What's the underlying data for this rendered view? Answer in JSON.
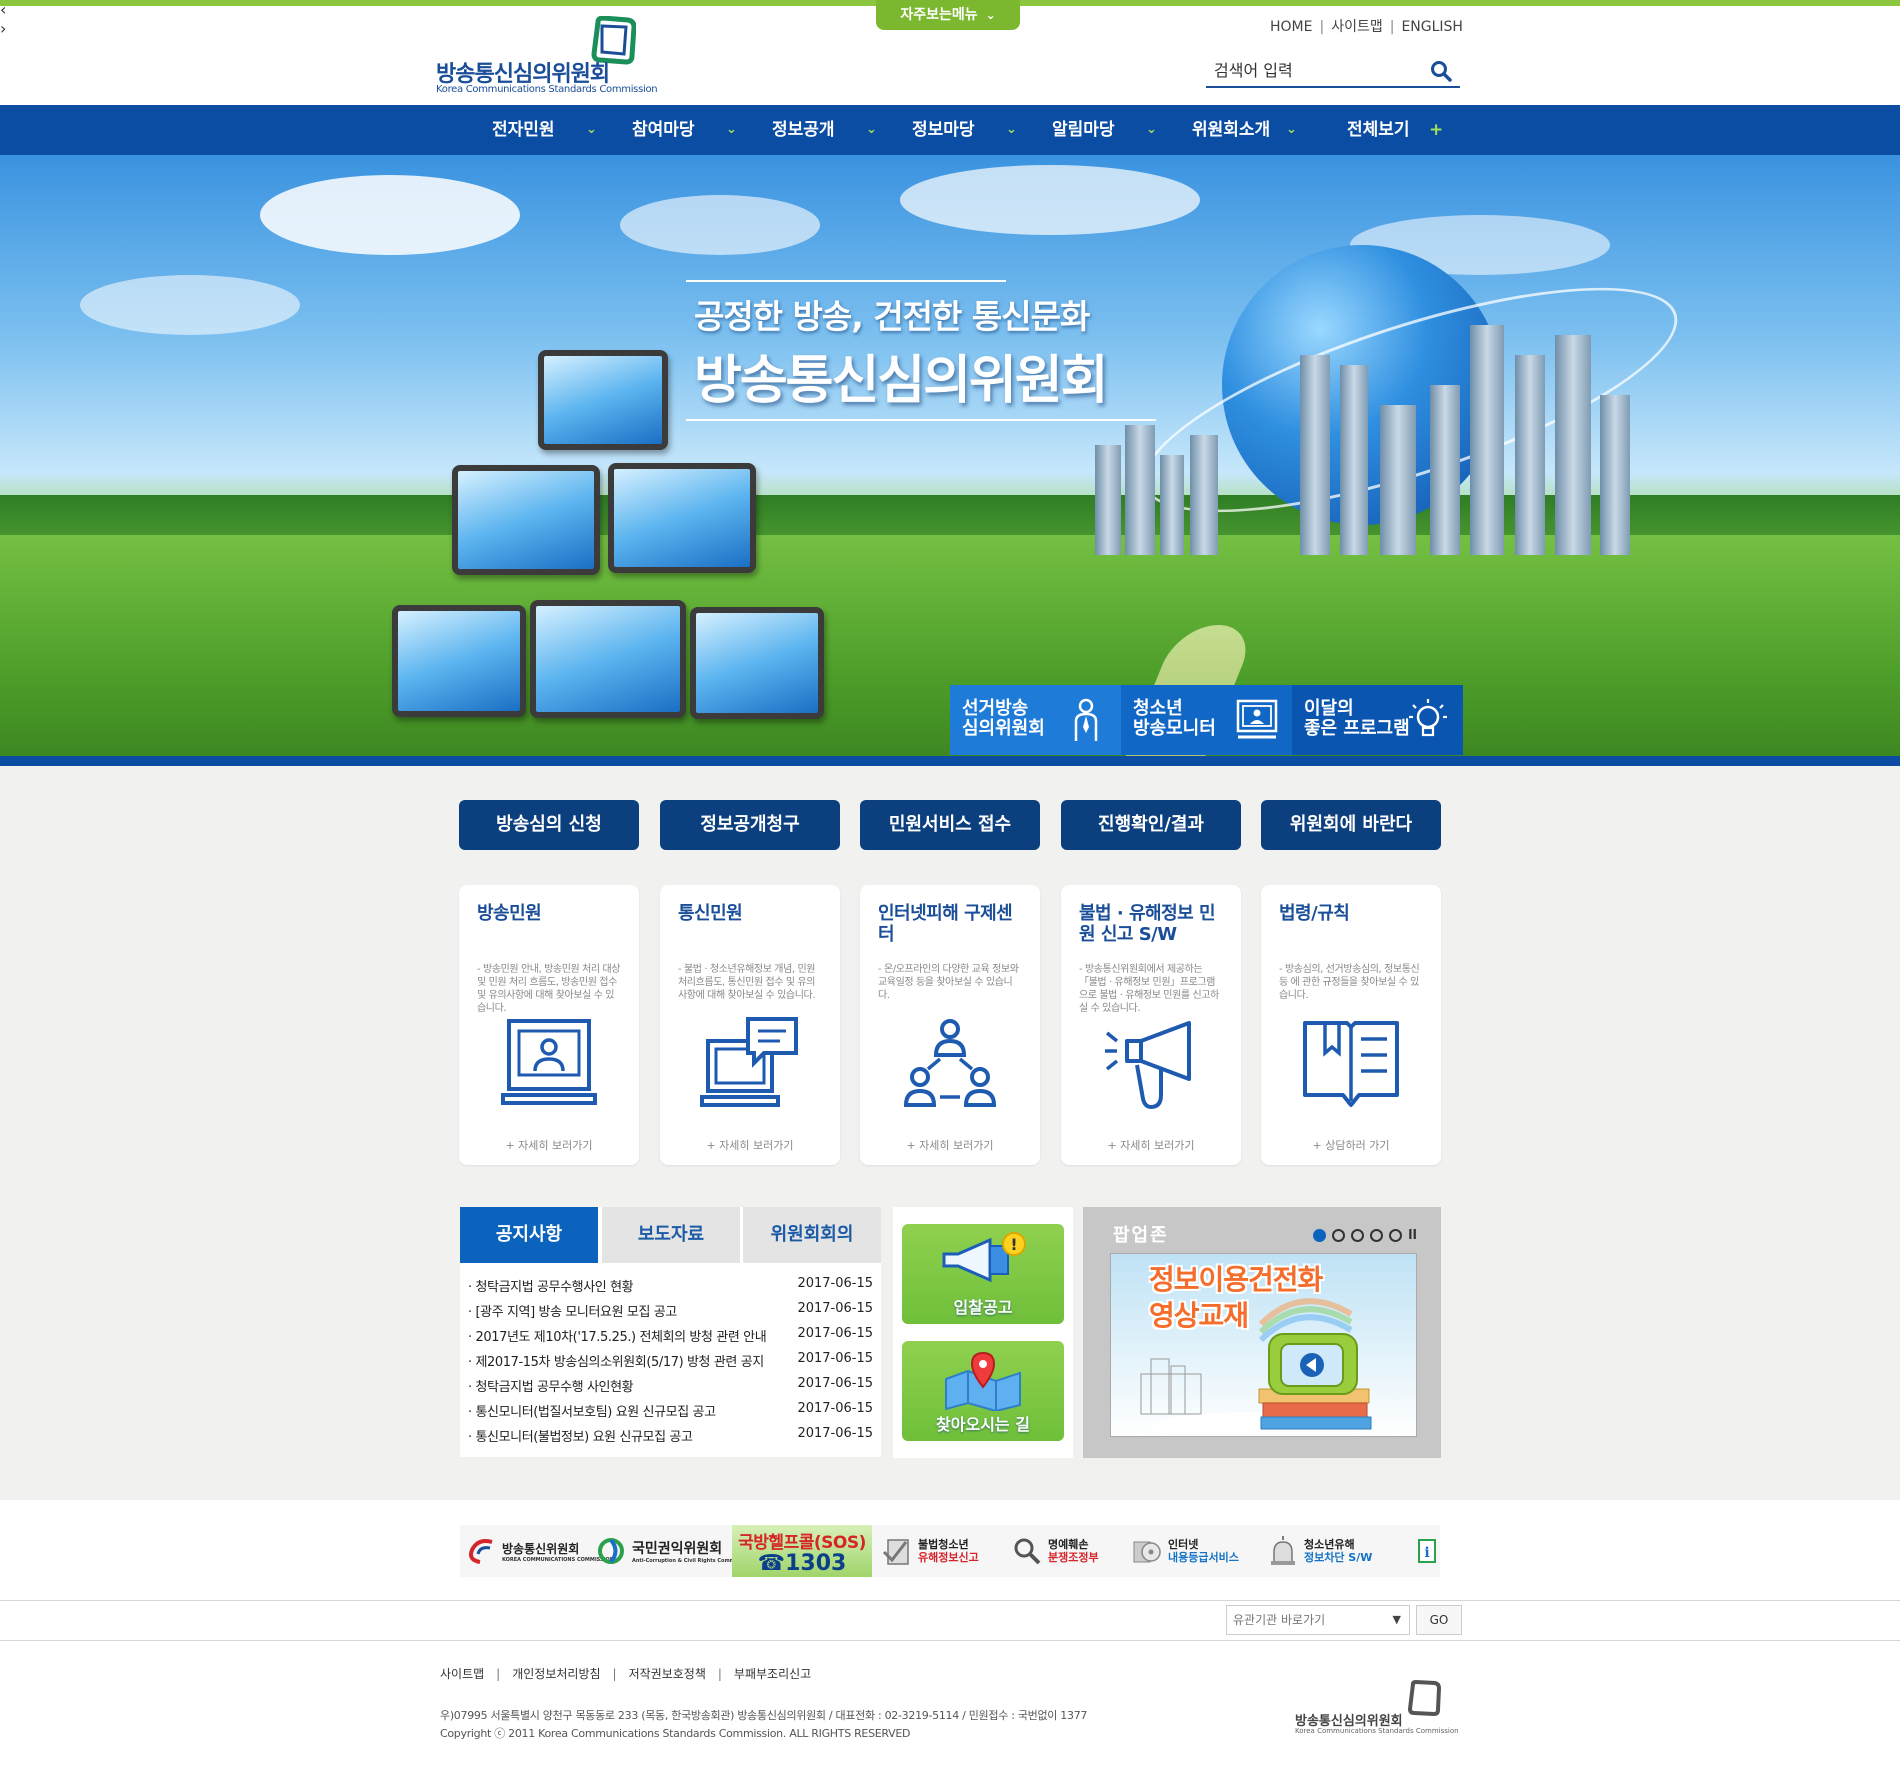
{
  "header": {
    "quick_menu": "자주보는메뉴",
    "logo_name": "방송통신심의위원회",
    "logo_eng": "Korea Communications Standards Commission",
    "util": [
      "HOME",
      "사이트맵",
      "ENGLISH"
    ],
    "search_value": "검색어 입력"
  },
  "gnb": [
    "전자민원",
    "참여마당",
    "정보공개",
    "정보마당",
    "알림마당",
    "위원회소개",
    "전체보기"
  ],
  "hero": {
    "sub": "공정한 방송, 건전한 통신문화",
    "main": "방송통신심의위원회",
    "quick": [
      {
        "line1": "선거방송",
        "line2": "심의위원회",
        "icon": "person-icon"
      },
      {
        "line1": "청소년",
        "line2": "방송모니터",
        "icon": "monitor-person-icon"
      },
      {
        "line1": "이달의",
        "line2": "좋은 프로그램",
        "icon": "lightbulb-icon"
      }
    ],
    "quick_colors": [
      "#1e7bd8",
      "#1067c6",
      "#0a55b0"
    ]
  },
  "buttons": [
    "방송심의 신청",
    "정보공개청구",
    "민원서비스 접수",
    "진행확인/결과",
    "위원회에 바란다"
  ],
  "cards": [
    {
      "title": "방송민원",
      "desc": "- 방송민원 안내, 방송민원 처리 대상 및 민원 처리 흐름도, 방송민원 접수 및 유의사항에 대해 찾아보실 수 있습니다.",
      "more": "+ 자세히 보러가기",
      "icon": "monitor-user-icon"
    },
    {
      "title": "통신민원",
      "desc": "- 불법 · 청소년유해정보 개념, 민원 처리흐름도, 통신민원 접수 및 유의사항에 대해 찾아보실 수 있습니다.",
      "more": "+ 자세히 보러가기",
      "icon": "computer-chat-icon"
    },
    {
      "title": "인터넷피해 구제센터",
      "desc": "- 온/오프라인의 다양한 교육 정보와 교육일정 등을 찾아보실 수 있습니다.",
      "more": "+ 자세히 보러가기",
      "icon": "people-network-icon"
    },
    {
      "title": "불법 · 유해정보 민원 신고 S/W",
      "desc": "- 방송통신위원회에서 제공하는 「불법 · 유해정보 민원」프로그램으로 불법 · 유해정보 민원를 신고하실 수 있습니다.",
      "more": "+ 자세히 보러가기",
      "icon": "megaphone-icon"
    },
    {
      "title": "법령/규칙",
      "desc": "- 방송심의, 선거방송심의, 정보통신 등 에 관한 규정들을 찾아보실 수 있습니다.",
      "more": "+ 상담하러 가기",
      "icon": "open-book-icon"
    }
  ],
  "board": {
    "tabs": [
      "공지사항",
      "보도자료",
      "위원회회의"
    ],
    "rows": [
      {
        "text": "· 청탁금지법 공무수행사인 현황",
        "date": "2017-06-15"
      },
      {
        "text": "· [광주 지역] 방송 모니터요원 모집 공고",
        "date": "2017-06-15"
      },
      {
        "text": "· 2017년도 제10차('17.5.25.) 전체회의 방청 관련 안내",
        "date": "2017-06-15"
      },
      {
        "text": "· 제2017-15차 방송심의소위원회(5/17) 방청 관련 공지",
        "date": "2017-06-15"
      },
      {
        "text": "· 청탁금지법 공무수행 사인현황",
        "date": "2017-06-15"
      },
      {
        "text": "· 통신모니터(법질서보호팀) 요원 신규모집 공고",
        "date": "2017-06-15"
      },
      {
        "text": "· 통신모니터(불법정보) 요원 신규모집 공고",
        "date": "2017-06-15"
      }
    ]
  },
  "tiles": [
    {
      "label": "입찰공고",
      "icon": "megaphone-alert-icon"
    },
    {
      "label": "찾아오시는 길",
      "icon": "map-pin-icon"
    }
  ],
  "popup": {
    "title": "팝업존",
    "banner_line1": "정보이용건전화",
    "banner_line2": "영상교재",
    "active_dot": 1,
    "dot_count": 5
  },
  "related": {
    "sites": [
      {
        "name": "방송통신위원회",
        "sub": "KOREA COMMUNICATIONS COMMISSION"
      },
      {
        "name": "국민권익위원회",
        "sub": "Anti-Corruption & Civil Rights Commission"
      },
      {
        "sos1": "국방헬프콜(SOS)",
        "sos2": "1303"
      },
      {
        "line1": "불법청소년",
        "line2": "유해정보신고"
      },
      {
        "line1": "명예훼손",
        "line2": "분쟁조정부"
      },
      {
        "line1": "인터넷",
        "line2": "내용등급서비스"
      },
      {
        "line1": "청소년유해",
        "line2": "정보차단 S/W"
      }
    ]
  },
  "footer": {
    "select_placeholder": "유관기관 바로가기",
    "go": "GO",
    "links": [
      "사이트맵",
      "개인정보처리방침",
      "저작권보호정책",
      "부패부조리신고"
    ],
    "address": "우)07995 서울특별시 양천구 목동동로 233 (목동, 한국방송회관) 방송통신심의위원회 / 대표전화 : 02-3219-5114 / 민원접수 : 국번없이 1377",
    "copyright": "Copyright ⓒ 2011 Korea Communications Standards Commission. ALL RIGHTS RESERVED",
    "logo_name": "방송통신심의위원회",
    "logo_eng": "Korea Communications Standards Commission"
  }
}
